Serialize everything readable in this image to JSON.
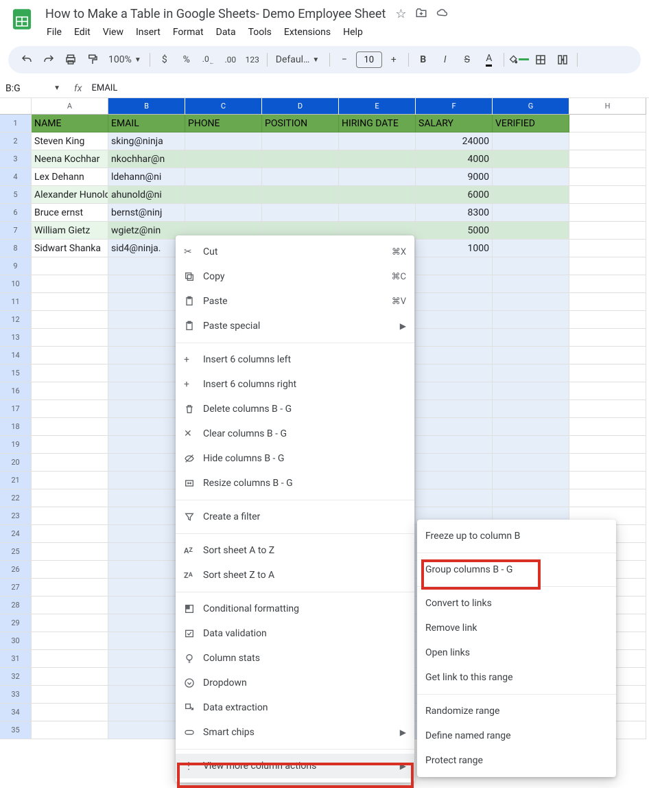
{
  "doc": {
    "title": "How to Make a Table in Google Sheets- Demo Employee Sheet"
  },
  "menubar": [
    "File",
    "Edit",
    "View",
    "Insert",
    "Format",
    "Data",
    "Tools",
    "Extensions",
    "Help"
  ],
  "toolbar": {
    "zoom": "100%",
    "font": "Defaul…",
    "fontsize": "10"
  },
  "namebox": "B:G",
  "formula": "EMAIL",
  "columns": [
    "A",
    "B",
    "C",
    "D",
    "E",
    "F",
    "G",
    "H"
  ],
  "selected_cols": [
    "B",
    "C",
    "D",
    "E",
    "F",
    "G"
  ],
  "headers": [
    "NAME",
    "EMAIL",
    "PHONE",
    "POSITION",
    "HIRING DATE",
    "SALARY",
    "VERIFIED"
  ],
  "table_rows": [
    {
      "name": "Steven King",
      "email": "sking@ninja",
      "salary": "24000"
    },
    {
      "name": "Neena Kochhar",
      "email": "nkochhar@n",
      "salary": "4000"
    },
    {
      "name": "Lex Dehann",
      "email": "ldehann@ni",
      "salary": "9000"
    },
    {
      "name": "Alexander Hunold",
      "email": "ahunold@ni",
      "salary": "6000"
    },
    {
      "name": "Bruce ernst",
      "email": "bernst@ninj",
      "salary": "8300"
    },
    {
      "name": "William Gietz",
      "email": "wgietz@nin",
      "salary": "5000"
    },
    {
      "name": "Sidwart Shanka",
      "email": "sid4@ninja.",
      "salary": "1000"
    }
  ],
  "row_alt": [
    false,
    true,
    false,
    true,
    false,
    true,
    false
  ],
  "empty_rows_start": 9,
  "empty_rows_end": 35,
  "context_menu": {
    "cut": {
      "label": "Cut",
      "shortcut": "⌘X"
    },
    "copy": {
      "label": "Copy",
      "shortcut": "⌘C"
    },
    "paste": {
      "label": "Paste",
      "shortcut": "⌘V"
    },
    "paste_special": "Paste special",
    "insert_left": "Insert 6 columns left",
    "insert_right": "Insert 6 columns right",
    "delete_cols": "Delete columns B - G",
    "clear_cols": "Clear columns B - G",
    "hide_cols": "Hide columns B - G",
    "resize_cols": "Resize columns B - G",
    "create_filter": "Create a filter",
    "sort_az": "Sort sheet A to Z",
    "sort_za": "Sort sheet Z to A",
    "cond_fmt": "Conditional formatting",
    "data_val": "Data validation",
    "col_stats": "Column stats",
    "dropdown": "Dropdown",
    "data_extract": "Data extraction",
    "smart_chips": "Smart chips",
    "view_more": "View more column actions"
  },
  "submenu": {
    "freeze": "Freeze up to column B",
    "group": "Group columns B - G",
    "convert_links": "Convert to links",
    "remove_link": "Remove link",
    "open_links": "Open links",
    "get_link": "Get link to this range",
    "randomize": "Randomize range",
    "named_range": "Define named range",
    "protect": "Protect range"
  }
}
